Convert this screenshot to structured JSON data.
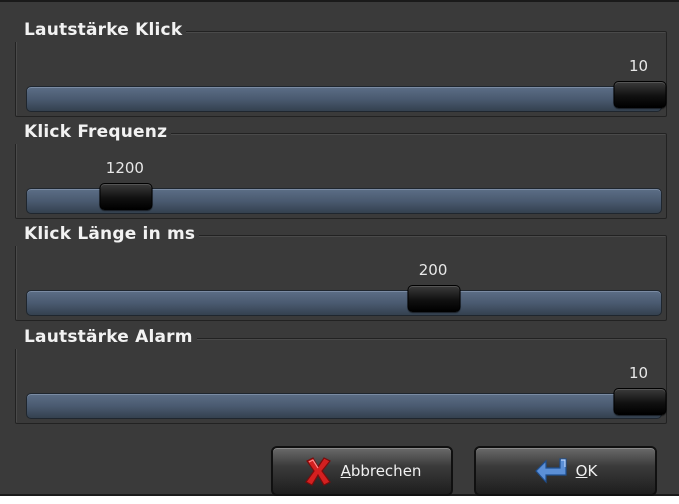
{
  "sliders": [
    {
      "title": "Lautstärke Klick",
      "value_text": "10",
      "level": 1.0
    },
    {
      "title": "Klick Frequenz",
      "value_text": "1200",
      "level": 0.125
    },
    {
      "title": "Klick Länge in ms",
      "value_text": "200",
      "level": 0.65
    },
    {
      "title": "Lautstärke Alarm",
      "value_text": "10",
      "level": 1.0
    }
  ],
  "buttons": {
    "cancel_mnemonic": "A",
    "cancel_rest": "bbrechen",
    "ok_mnemonic": "O",
    "ok_rest": "K"
  },
  "colors": {
    "dialog_bg": "#3a3a3a",
    "track": "#4a5a70",
    "handle": "#111111",
    "cancel_icon": "#d42020",
    "ok_icon": "#5b8fd6"
  },
  "icons": {
    "cancel": "red-x-icon",
    "ok": "enter-arrow-icon"
  }
}
